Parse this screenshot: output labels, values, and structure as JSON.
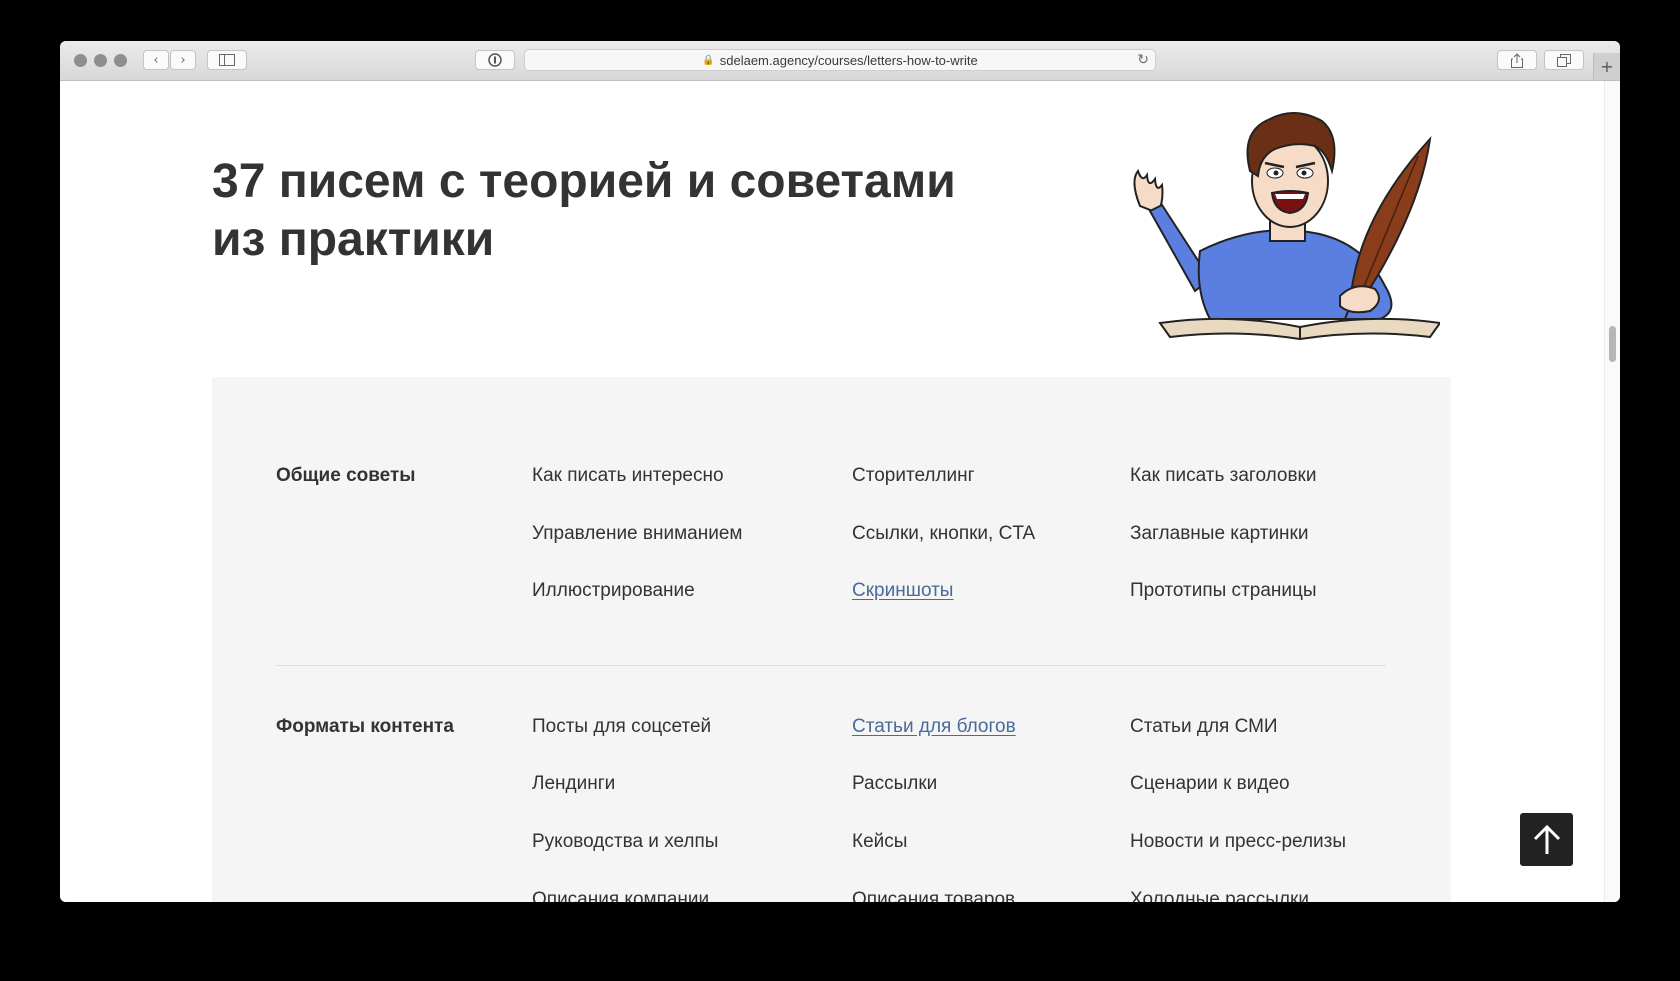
{
  "browser": {
    "url": "sdelaem.agency/courses/letters-how-to-write",
    "lock_icon": "lock-icon",
    "reload_icon": "reload-icon"
  },
  "page": {
    "headline_line1": "37 писем с теорией и советами",
    "headline_line2": "из практики"
  },
  "sections": [
    {
      "title": "Общие советы",
      "links": [
        {
          "label": "Как писать интересно",
          "active": false
        },
        {
          "label": "Сторителлинг",
          "active": false
        },
        {
          "label": "Как писать заголовки",
          "active": false
        },
        {
          "label": "Управление вниманием",
          "active": false
        },
        {
          "label": "Ссылки, кнопки, CTA",
          "active": false
        },
        {
          "label": "Заглавные картинки",
          "active": false
        },
        {
          "label": "Иллюстрирование",
          "active": false
        },
        {
          "label": "Скриншоты",
          "active": true
        },
        {
          "label": "Прототипы страницы",
          "active": false
        }
      ]
    },
    {
      "title": "Форматы контента",
      "links": [
        {
          "label": "Посты для соцсетей",
          "active": false
        },
        {
          "label": "Статьи для блогов",
          "active": true
        },
        {
          "label": "Статьи для СМИ",
          "active": false
        },
        {
          "label": "Лендинги",
          "active": false
        },
        {
          "label": "Рассылки",
          "active": false
        },
        {
          "label": "Сценарии к видео",
          "active": false
        },
        {
          "label": "Руководства и хелпы",
          "active": false
        },
        {
          "label": "Кейсы",
          "active": false
        },
        {
          "label": "Новости и пресс-релизы",
          "active": false
        },
        {
          "label": "Описания компании",
          "active": false
        },
        {
          "label": "Описания товаров",
          "active": false
        },
        {
          "label": "Холодные рассылки",
          "active": false
        }
      ]
    }
  ],
  "colors": {
    "active_link": "#4a6a9b",
    "text": "#333333",
    "panel_bg": "#f5f5f5"
  }
}
